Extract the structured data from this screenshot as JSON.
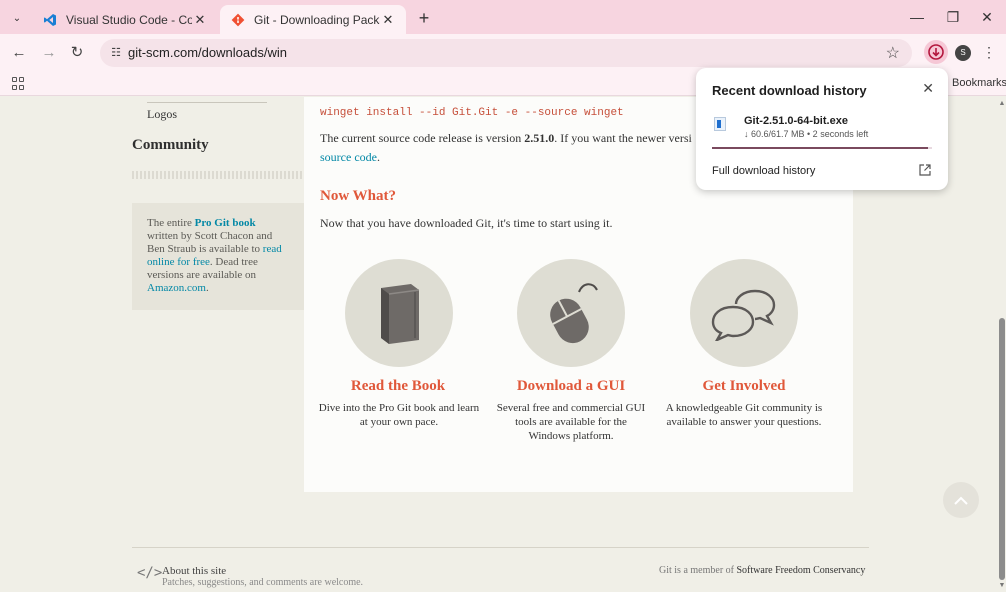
{
  "browser": {
    "tabs": [
      {
        "title": "Visual Studio Code - Code Editi",
        "active": false
      },
      {
        "title": "Git - Downloading Package",
        "active": true
      }
    ],
    "url": "git-scm.com/downloads/win",
    "bookmarks_label": "Bookmarks",
    "avatar_letter": "S"
  },
  "sidebar": {
    "logos": "Logos",
    "community": "Community",
    "book_pre": "The entire ",
    "book_link": "Pro Git book",
    "book_mid": " written by Scott Chacon and Ben Straub is available to ",
    "book_read": "read online for free",
    "book_post": ". Dead tree versions are available on ",
    "book_amazon": "Amazon.com",
    "book_end": "."
  },
  "main": {
    "code": "winget install --id Git.Git -e --source winget",
    "src_pre": "The current source code release is version ",
    "src_version": "2.51.0",
    "src_post": ". If you want the newer versi",
    "src_link": "source code",
    "src_end": ".",
    "now_what": "Now What?",
    "now_desc": "Now that you have downloaded Git, it's time to start using it.",
    "features": [
      {
        "title": "Read the Book",
        "desc": "Dive into the Pro Git book and learn at your own pace."
      },
      {
        "title": "Download a GUI",
        "desc": "Several free and commercial GUI tools are available for the Windows platform."
      },
      {
        "title": "Get Involved",
        "desc": "A knowledgeable Git community is available to answer your questions."
      }
    ]
  },
  "footer": {
    "icon": "</>",
    "about": "About this site",
    "sub": "Patches, suggestions, and comments are welcome.",
    "member_pre": "Git is a member of ",
    "member_link": "Software Freedom Conservancy"
  },
  "download_popup": {
    "header": "Recent download history",
    "file_name": "Git-2.51.0-64-bit.exe",
    "status": "↓ 60.6/61.7 MB • 2 seconds left",
    "progress": 0.98,
    "full_history": "Full download history"
  }
}
